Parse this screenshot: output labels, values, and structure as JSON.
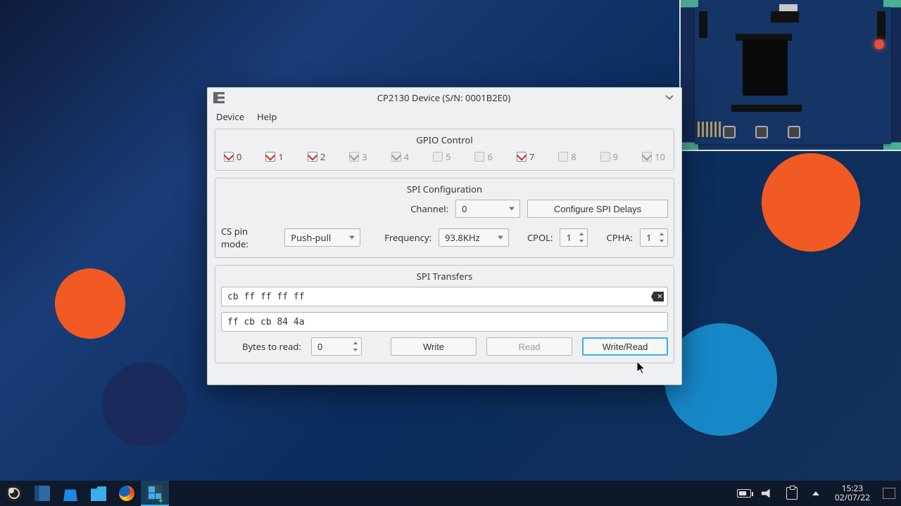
{
  "window": {
    "title": "CP2130 Device (S/N: 0001B2E0)",
    "menu": {
      "device": "Device",
      "help": "Help"
    }
  },
  "gpio": {
    "title": "GPIO Control",
    "pins": [
      {
        "n": "0",
        "checked": true,
        "enabled": true
      },
      {
        "n": "1",
        "checked": true,
        "enabled": true
      },
      {
        "n": "2",
        "checked": true,
        "enabled": true
      },
      {
        "n": "3",
        "checked": true,
        "enabled": false
      },
      {
        "n": "4",
        "checked": true,
        "enabled": false
      },
      {
        "n": "5",
        "checked": false,
        "enabled": false
      },
      {
        "n": "6",
        "checked": false,
        "enabled": false
      },
      {
        "n": "7",
        "checked": true,
        "enabled": true
      },
      {
        "n": "8",
        "checked": false,
        "enabled": false
      },
      {
        "n": "9",
        "checked": false,
        "enabled": false
      },
      {
        "n": "10",
        "checked": true,
        "enabled": false
      }
    ]
  },
  "spi_conf": {
    "title": "SPI Configuration",
    "channel_lbl": "Channel:",
    "channel_val": "0",
    "configure_btn": "Configure SPI Delays",
    "cs_mode_lbl": "CS pin mode:",
    "cs_mode_val": "Push-pull",
    "freq_lbl": "Frequency:",
    "freq_val": "93.8KHz",
    "cpol_lbl": "CPOL:",
    "cpol_val": "1",
    "cpha_lbl": "CPHA:",
    "cpha_val": "1"
  },
  "spi_xfer": {
    "title": "SPI Transfers",
    "tx": "cb ff ff ff ff",
    "rx": "ff cb cb 84 4a",
    "bytes_lbl": "Bytes to read:",
    "bytes_val": "0",
    "write_btn": "Write",
    "read_btn": "Read",
    "writeread_btn": "Write/Read"
  },
  "taskbar": {
    "time": "15:23",
    "date": "02/07/22"
  }
}
